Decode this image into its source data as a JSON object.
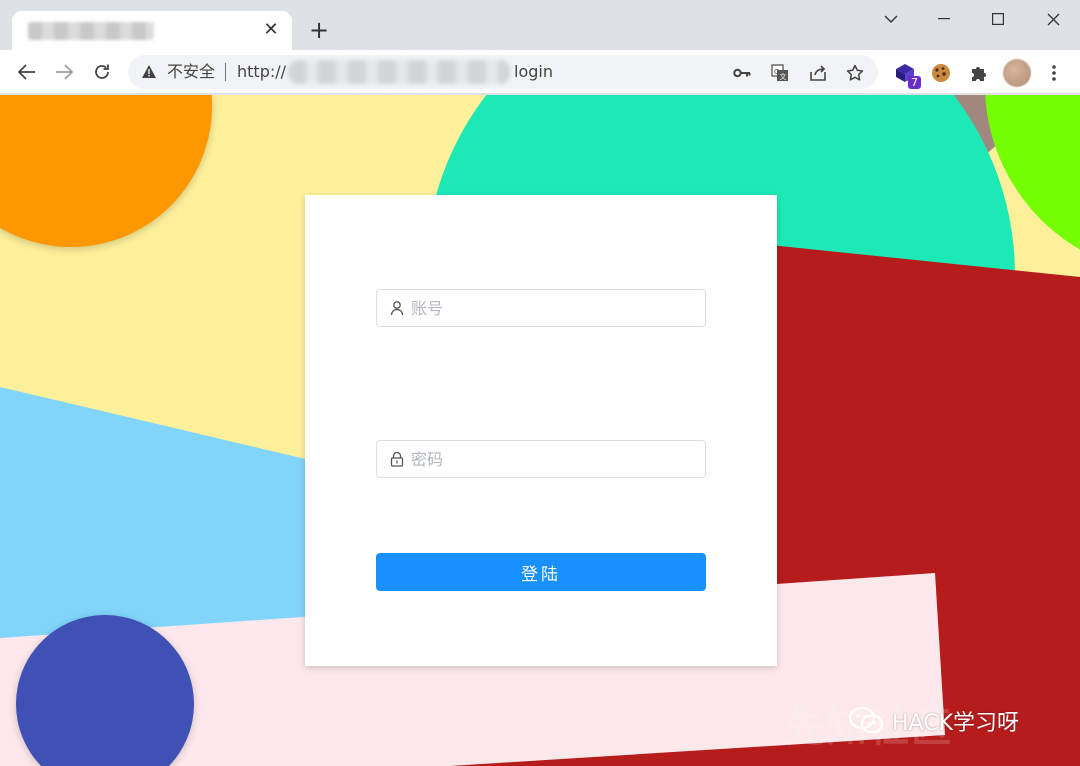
{
  "browser": {
    "tab": {
      "title": ""
    },
    "toolbar": {
      "security_label": "不安全",
      "url_prefix": "http://",
      "url_path": "login"
    },
    "extensions": [
      {
        "icon": "extension-cube-icon",
        "badge": "7"
      },
      {
        "icon": "cookie-icon"
      },
      {
        "icon": "puzzle-icon"
      }
    ]
  },
  "login": {
    "username_placeholder": "账号",
    "password_placeholder": "密码",
    "submit_label": "登陆"
  },
  "watermark": {
    "text": "HACK学习呀",
    "background_text": "先知社区"
  },
  "colors": {
    "primary_button": "#1890ff",
    "bg_yellow": "#fdf09a",
    "bg_orange": "#ff9800",
    "bg_teal": "#1de9b6",
    "bg_brown": "#a1887f",
    "bg_lime": "#76ff03",
    "bg_red": "#b71c1c",
    "bg_lightblue": "#81d4fa",
    "bg_pink": "#fde8ec",
    "bg_indigo": "#3f51b5"
  }
}
